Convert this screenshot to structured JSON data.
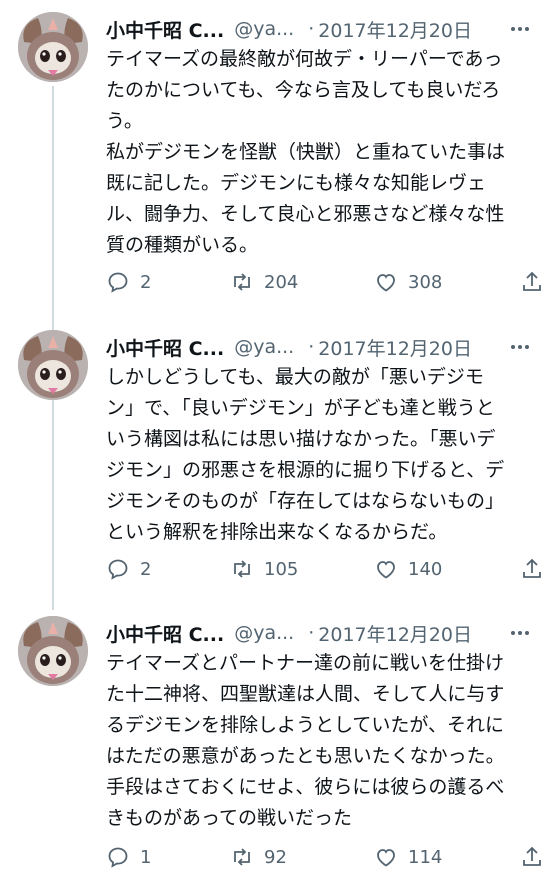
{
  "tweets": [
    {
      "author_name": "小中千昭 C...",
      "handle": "@ya...",
      "separator": "·",
      "date": "2017年12月20日",
      "lines": [
        "テイマーズの最終敵が何故デ・リーパーであっ",
        "たのかについても、今なら言及しても良いだろ",
        "う。",
        "私がデジモンを怪獣（快獣）と重ねていた事は",
        "既に記した。デジモンにも様々な知能レヴェ",
        "ル、闘争力、そして良心と邪悪さなど様々な性",
        "質の種類がいる。"
      ],
      "replies": "2",
      "retweets": "204",
      "likes": "308"
    },
    {
      "author_name": "小中千昭 C...",
      "handle": "@ya...",
      "separator": "·",
      "date": "2017年12月20日",
      "lines": [
        "しかしどうしても、最大の敵が「悪いデジモ",
        "ン」で、「良いデジモン」が子ども達と戦うと",
        "いう構図は私には思い描けなかった。「悪いデ",
        "ジモン」の邪悪さを根源的に掘り下げると、デ",
        "ジモンそのものが「存在してはならないもの」",
        "という解釈を排除出来なくなるからだ。"
      ],
      "replies": "2",
      "retweets": "105",
      "likes": "140"
    },
    {
      "author_name": "小中千昭 C...",
      "handle": "@ya...",
      "separator": "·",
      "date": "2017年12月20日",
      "lines": [
        "テイマーズとパートナー達の前に戦いを仕掛け",
        "た十二神将、四聖獣達は人間、そして人に与す",
        "るデジモンを排除しようとしていたが、それに",
        "はただの悪意があったとも思いたくなかった。",
        "手段はさておくにせよ、彼らには彼らの護るべ",
        "きものがあっての戦いだった"
      ],
      "replies": "1",
      "retweets": "92",
      "likes": "114"
    }
  ],
  "icons": {
    "reply": "reply-icon",
    "retweet": "retweet-icon",
    "like": "heart-icon",
    "share": "share-icon",
    "more": "more-icon"
  },
  "colors": {
    "text": "#0f1419",
    "secondary": "#536471",
    "thread_line": "#cfd9de"
  }
}
